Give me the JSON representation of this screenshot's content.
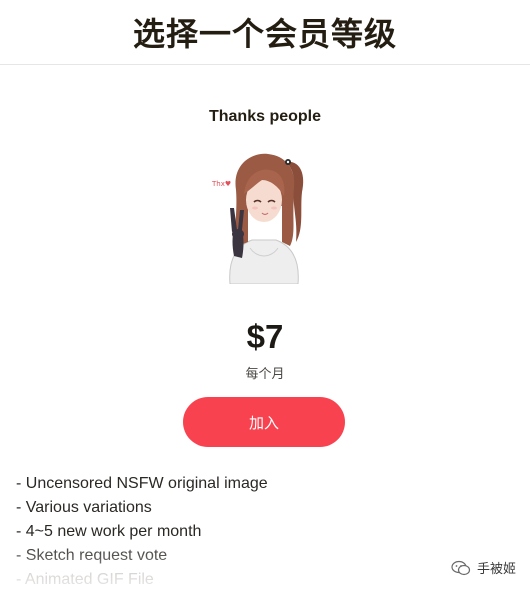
{
  "header": {
    "title": "选择一个会员等级"
  },
  "tier": {
    "name": "Thanks people",
    "image_icon": "anime-girl-peace-sign-illustration",
    "image_caption": "Thx♥",
    "price": "$7",
    "period": "每个月",
    "join_label": "加入",
    "accent_color": "#f8424f"
  },
  "benefits": [
    "- Uncensored NSFW original image",
    "- Various variations",
    "- 4~5 new work per month",
    "- Sketch request vote",
    "- Animated GIF File"
  ],
  "watermark": {
    "icon": "wechat-icon",
    "text": "手被姬"
  }
}
